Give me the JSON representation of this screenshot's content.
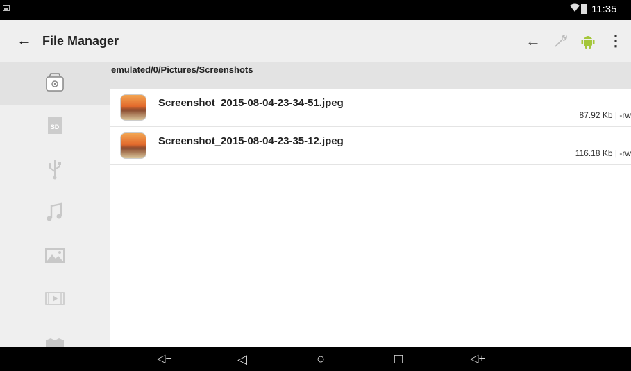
{
  "status_bar": {
    "time": "11:35",
    "icons": [
      "notification-icon",
      "wifi-icon",
      "battery-icon"
    ]
  },
  "app_bar": {
    "title": "File Manager",
    "actions": [
      "back-arrow-icon",
      "wrench-icon",
      "android-icon",
      "overflow-menu-icon"
    ]
  },
  "sidebar": {
    "items": [
      {
        "icon": "internal-storage-icon",
        "active": true
      },
      {
        "icon": "sd-card-icon",
        "label": "SD"
      },
      {
        "icon": "usb-icon"
      },
      {
        "icon": "music-icon"
      },
      {
        "icon": "image-icon"
      },
      {
        "icon": "video-icon"
      },
      {
        "icon": "book-icon"
      }
    ]
  },
  "path": "emulated/0/Pictures/Screenshots",
  "files": [
    {
      "name": "Screenshot_2015-08-04-23-34-51.jpeg",
      "size": "87.92 Kb",
      "perms": "-rw"
    },
    {
      "name": "Screenshot_2015-08-04-23-35-12.jpeg",
      "size": "116.18 Kb",
      "perms": "-rw"
    }
  ],
  "nav_bar": {
    "volume_down": "◁−",
    "back": "◁",
    "home": "○",
    "recents": "□",
    "volume_up": "◁+"
  },
  "colors": {
    "android_green": "#a4c639",
    "appbar_bg": "#efefef",
    "pathbar_bg": "#e3e3e3"
  }
}
